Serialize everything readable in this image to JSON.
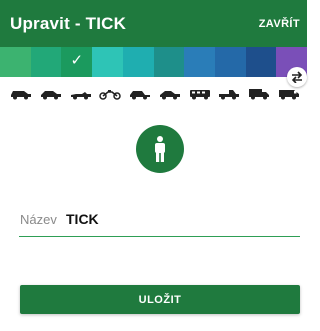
{
  "header": {
    "title": "Upravit - TICK",
    "close_label": "ZAVŘÍT",
    "background": "#1f7a3e"
  },
  "color_swatches": [
    {
      "color": "#3cb370",
      "selected": false
    },
    {
      "color": "#22a878",
      "selected": false
    },
    {
      "color": "#1b9a5e",
      "selected": true
    },
    {
      "color": "#2ec4b6",
      "selected": false
    },
    {
      "color": "#1faeb0",
      "selected": false
    },
    {
      "color": "#1e8f8a",
      "selected": false
    },
    {
      "color": "#2a7db8",
      "selected": false
    },
    {
      "color": "#2469a8",
      "selected": false
    },
    {
      "color": "#1e4f8c",
      "selected": false
    },
    {
      "color": "#7a4fb8",
      "selected": false
    }
  ],
  "swap_icon": "swap-arrows-icon",
  "vehicle_icons": [
    "car-icon",
    "sedan-icon",
    "convertible-icon",
    "motorcycle-icon",
    "hatchback-icon",
    "coupe-icon",
    "bus-icon",
    "pickup-icon",
    "truck-icon",
    "van-icon"
  ],
  "avatar": {
    "icon": "person-icon",
    "background": "#1f7a3e"
  },
  "name_field": {
    "label": "Název",
    "value": "TICK"
  },
  "save_button": {
    "label": "ULOŽIT"
  }
}
